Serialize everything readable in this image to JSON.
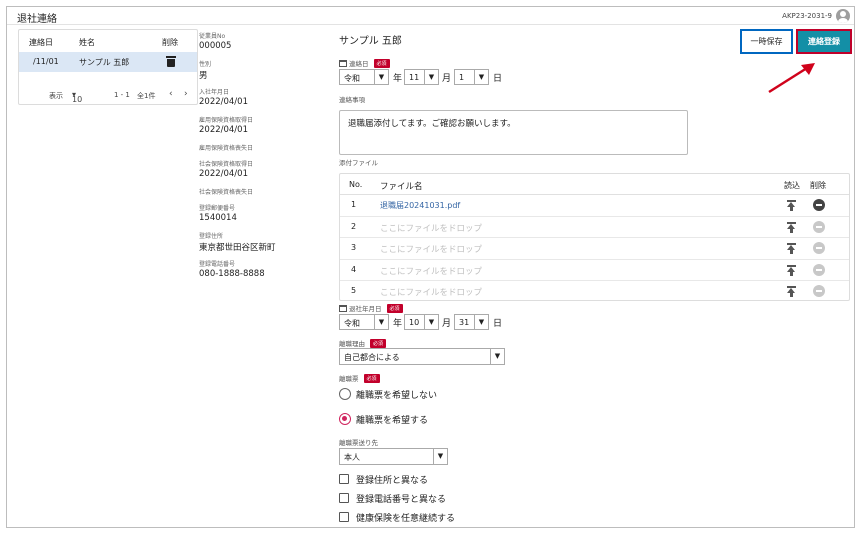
{
  "header": {
    "title": "退社連絡",
    "user_id": "AKP23-2031-9"
  },
  "employee_list": {
    "columns": [
      "連絡日",
      "姓名",
      "削除"
    ],
    "rows": [
      {
        "date": "/11/01",
        "name": "サンプル 五郎"
      }
    ],
    "footer": {
      "display_label": "表示",
      "page_size": "10",
      "range": "1 - 1",
      "total": "全1件"
    }
  },
  "employee_info": [
    {
      "label": "従業員No",
      "value": "000005"
    },
    {
      "label": "性別",
      "value": "男"
    },
    {
      "label": "入社年月日",
      "value": "2022/04/01"
    },
    {
      "label": "雇用保険資格取得日",
      "value": "2022/04/01"
    },
    {
      "label": "雇用保険資格喪失日",
      "value": ""
    },
    {
      "label": "社会保険資格取得日",
      "value": "2022/04/01"
    },
    {
      "label": "社会保険資格喪失日",
      "value": ""
    },
    {
      "label": "登録郵便番号",
      "value": "1540014"
    },
    {
      "label": "登録住所",
      "value": "東京都世田谷区新町"
    },
    {
      "label": "登録電話番号",
      "value": "080-1888-8888"
    }
  ],
  "form": {
    "employee_name": "サンプル 五郎",
    "buttons": {
      "save_draft": "一時保存",
      "register": "連絡登録"
    },
    "required_badge": "必須",
    "contact_date": {
      "label": "連絡日",
      "era": "令和",
      "year_unit": "年",
      "month": "11",
      "month_unit": "月",
      "day": "1",
      "day_unit": "日"
    },
    "message": {
      "label": "連絡事項",
      "value": "退職届添付してます。ご確認お願いします。"
    },
    "attachments": {
      "label": "添付ファイル",
      "columns": {
        "no": "No.",
        "file_name": "ファイル名",
        "load": "読込",
        "delete": "削除"
      },
      "rows": [
        {
          "no": "1",
          "name": "退職届20241031.pdf",
          "has_file": true
        },
        {
          "no": "2",
          "name": "ここにファイルをドロップ",
          "has_file": false
        },
        {
          "no": "3",
          "name": "ここにファイルをドロップ",
          "has_file": false
        },
        {
          "no": "4",
          "name": "ここにファイルをドロップ",
          "has_file": false
        },
        {
          "no": "5",
          "name": "ここにファイルをドロップ",
          "has_file": false
        }
      ]
    },
    "leave_date": {
      "label": "退社年月日",
      "era": "令和",
      "year_unit": "年",
      "month": "10",
      "month_unit": "月",
      "day": "31",
      "day_unit": "日"
    },
    "reason": {
      "label": "離職理由",
      "value": "自己都合による"
    },
    "separation_slip": {
      "label": "離職票",
      "options": [
        {
          "label": "離職票を希望しない",
          "selected": false
        },
        {
          "label": "離職票を希望する",
          "selected": true
        }
      ]
    },
    "slip_destination": {
      "label": "離職票送り先",
      "value": "本人"
    },
    "checkboxes": [
      {
        "label": "登録住所と異なる",
        "checked": false
      },
      {
        "label": "登録電話番号と異なる",
        "checked": false
      },
      {
        "label": "健康保険を任意継続する",
        "checked": false
      }
    ]
  },
  "colors": {
    "register_bg": "#138fa6",
    "register_border": "#c0002a",
    "save_border": "#0067c0",
    "required": "#c2002b",
    "radio_selected": "#d0245e",
    "selected_row": "#dbe7f5"
  }
}
